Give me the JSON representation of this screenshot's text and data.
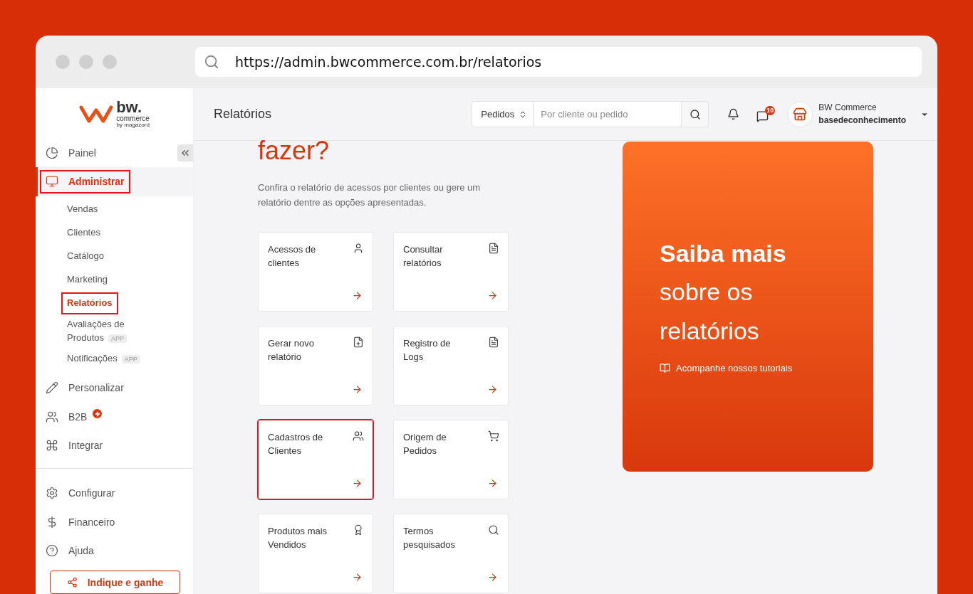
{
  "browser": {
    "url": "https://admin.bwcommerce.com.br/relatorios"
  },
  "logo": {
    "name": "bw.",
    "sub": "commerce",
    "by": "by magazord"
  },
  "sidebar": {
    "items": [
      {
        "label": "Painel",
        "selected": false,
        "highlighted": false
      },
      {
        "label": "Administrar",
        "selected": true,
        "highlighted": true,
        "children": [
          {
            "label": "Vendas",
            "selected": false,
            "highlighted": false
          },
          {
            "label": "Clientes",
            "selected": false,
            "highlighted": false
          },
          {
            "label": "Catálogo",
            "selected": false,
            "highlighted": false
          },
          {
            "label": "Marketing",
            "selected": false,
            "highlighted": false
          },
          {
            "label": "Relatórios",
            "selected": true,
            "highlighted": true
          },
          {
            "label": "Avaliações de Produtos",
            "badge": "APP",
            "selected": false,
            "highlighted": false
          },
          {
            "label": "Notificações",
            "badge": "APP",
            "selected": false,
            "highlighted": false
          }
        ]
      },
      {
        "label": "Personalizar",
        "selected": false,
        "highlighted": false
      },
      {
        "label": "B2B",
        "alert": true,
        "selected": false,
        "highlighted": false
      },
      {
        "label": "Integrar",
        "selected": false,
        "highlighted": false
      }
    ],
    "bottom_items": [
      {
        "label": "Configurar",
        "selected": false,
        "highlighted": false
      },
      {
        "label": "Financeiro",
        "selected": false,
        "highlighted": false
      },
      {
        "label": "Ajuda",
        "selected": false,
        "highlighted": false
      }
    ],
    "refer_button": "Indique e ganhe"
  },
  "header": {
    "title": "Relatórios",
    "search_type": "Pedidos",
    "search": {
      "placeholder": "Por cliente ou pedido"
    },
    "messages_count": "10",
    "account": {
      "name": "BW Commerce",
      "store": "basedeconhecimento"
    }
  },
  "intro": {
    "heading": "fazer?",
    "text": "Confira o relatório de acessos por clientes ou gere um relatório dentre as opções apresentadas."
  },
  "cards": [
    {
      "title": "Acessos de clientes",
      "highlighted": false
    },
    {
      "title": "Consultar relatórios",
      "highlighted": false
    },
    {
      "title": "Gerar novo relatório",
      "highlighted": false
    },
    {
      "title": "Registro de Logs",
      "highlighted": false
    },
    {
      "title": "Cadastros de Clientes",
      "highlighted": true
    },
    {
      "title": "Origem de Pedidos",
      "highlighted": false
    },
    {
      "title": "Produtos mais Vendidos",
      "highlighted": false
    },
    {
      "title": "Termos pesquisados",
      "highlighted": false
    }
  ],
  "promo": {
    "title_bold": "Saiba mais",
    "title_rest": "sobre os relatórios",
    "link": "Acompanhe nossos tutoriais"
  }
}
